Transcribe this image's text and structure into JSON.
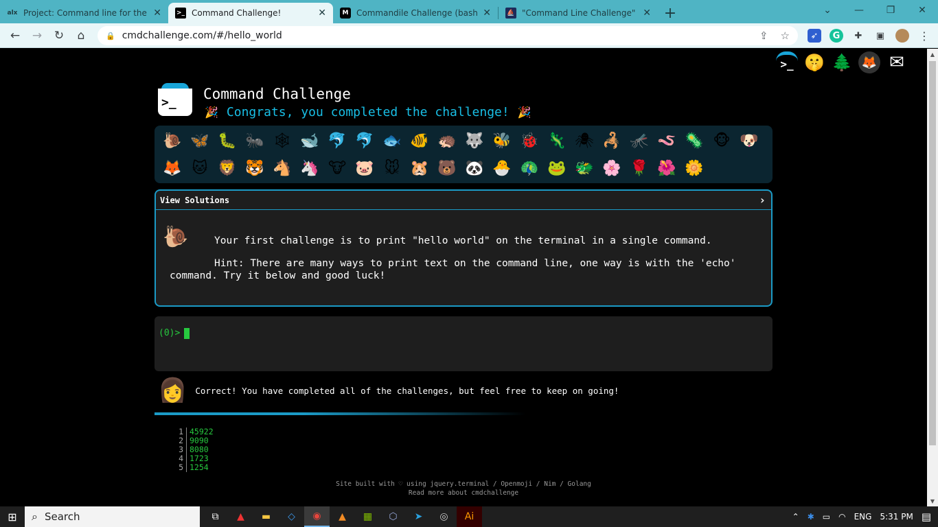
{
  "browser": {
    "tabs": [
      {
        "favicon": "alx",
        "title": "Project: Command line for the w",
        "active": false
      },
      {
        "favicon": ">_",
        "title": "Command Challenge!",
        "active": true
      },
      {
        "favicon": "M",
        "title": "Commandile Challenge (bash). Th",
        "active": false
      },
      {
        "favicon": "⛵",
        "title": "\"Command Line Challenge\" — Ja",
        "active": false
      }
    ],
    "url": "cmdchallenge.com/#/hello_world"
  },
  "page": {
    "title": "Command Challenge",
    "congrats": "Congrats, you completed the challenge!",
    "top_icons": [
      "cmdchallenge-icon",
      "shushing-face-icon",
      "tree-icon",
      "gitlab-icon",
      "mail-icon"
    ],
    "emojis": [
      "🐌",
      "🦋",
      "🐛",
      "🐜",
      "🕸",
      "🐋",
      "🐬",
      "🐬",
      "🐟",
      "🐠",
      "🦔",
      "🐺",
      "🐝",
      "🐞",
      "🦎",
      "🕷",
      "🦂",
      "🦟",
      "🪱",
      "🦠",
      "🐵",
      "🐶",
      "🦊",
      "🐱",
      "🦁",
      "🐯",
      "🐴",
      "🦄",
      "🐮",
      "🐷",
      "🐭",
      "🐹",
      "🐻",
      "🐼",
      "🐣",
      "🦚",
      "🐸",
      "🐲",
      "🌸",
      "🌹",
      "🌺",
      "🌼"
    ],
    "solutions": {
      "header": "View Solutions",
      "challenge": "Your first challenge is to print \"hello world\" on the terminal in a single command.",
      "hint": "Hint: There are many ways to print text on the command line, one way is with the 'echo' command. Try it below and good luck!"
    },
    "terminal": {
      "prompt": "(0)>"
    },
    "result": {
      "message": "Correct! You have completed all of the challenges, but feel free to keep on going!"
    },
    "scores": [
      {
        "n": "1",
        "v": "45922"
      },
      {
        "n": "2",
        "v": "9090"
      },
      {
        "n": "3",
        "v": "8080"
      },
      {
        "n": "4",
        "v": "1723"
      },
      {
        "n": "5",
        "v": "1254"
      }
    ],
    "footer": {
      "line1": "Site built with ♡ using jquery.terminal / Openmoji / Nim / Golang",
      "line2": "Read more about cmdchallenge"
    }
  },
  "taskbar": {
    "search_label": "Search",
    "language": "ENG",
    "time": "5:31 PM"
  }
}
